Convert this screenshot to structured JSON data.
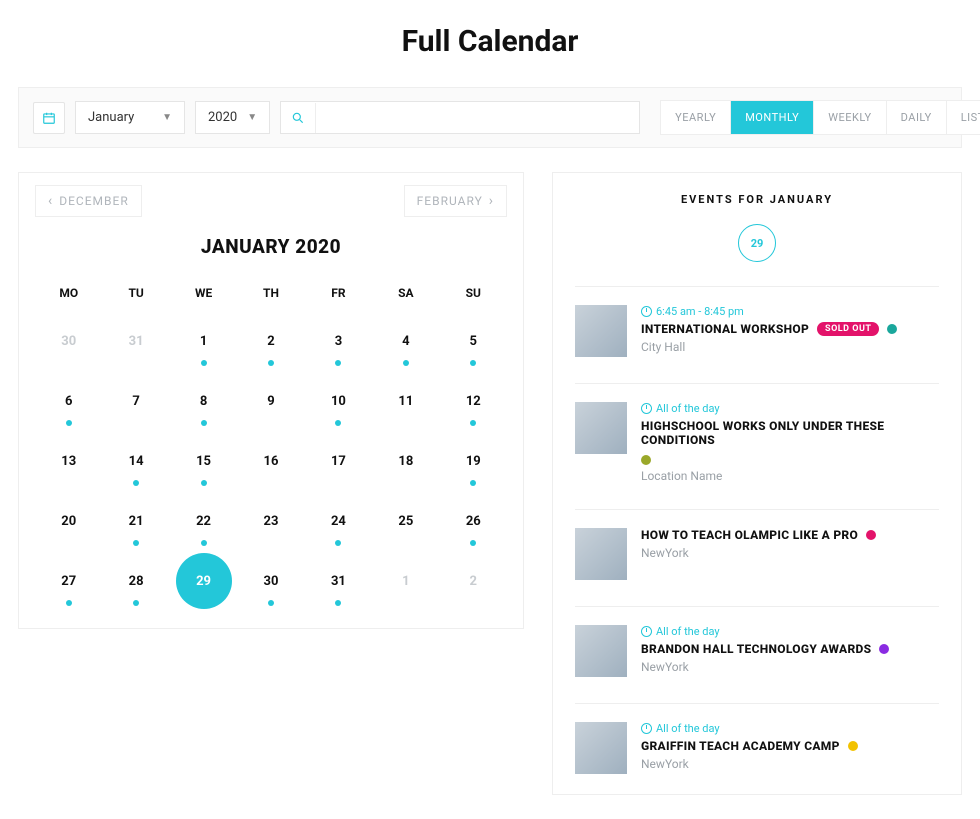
{
  "title": "Full Calendar",
  "toolbar": {
    "month_select": "January",
    "year_select": "2020",
    "views": [
      "YEARLY",
      "MONTHLY",
      "WEEKLY",
      "DAILY",
      "LIST"
    ],
    "active_view": "MONTHLY"
  },
  "calendar": {
    "prev_label": "DECEMBER",
    "next_label": "FEBRUARY",
    "heading": "JANUARY 2020",
    "weekdays": [
      "MO",
      "TU",
      "WE",
      "TH",
      "FR",
      "SA",
      "SU"
    ],
    "weeks": [
      [
        {
          "num": "30",
          "dim": true,
          "dot": false
        },
        {
          "num": "31",
          "dim": true,
          "dot": false
        },
        {
          "num": "1",
          "dot": true
        },
        {
          "num": "2",
          "dot": true
        },
        {
          "num": "3",
          "dot": true
        },
        {
          "num": "4",
          "dot": true
        },
        {
          "num": "5",
          "dot": true
        }
      ],
      [
        {
          "num": "6",
          "dot": true
        },
        {
          "num": "7",
          "dot": false
        },
        {
          "num": "8",
          "dot": true
        },
        {
          "num": "9",
          "dot": false
        },
        {
          "num": "10",
          "dot": true
        },
        {
          "num": "11",
          "dot": false
        },
        {
          "num": "12",
          "dot": true
        }
      ],
      [
        {
          "num": "13",
          "dot": false
        },
        {
          "num": "14",
          "dot": true
        },
        {
          "num": "15",
          "dot": true
        },
        {
          "num": "16",
          "dot": false
        },
        {
          "num": "17",
          "dot": false
        },
        {
          "num": "18",
          "dot": false
        },
        {
          "num": "19",
          "dot": true
        }
      ],
      [
        {
          "num": "20",
          "dot": false
        },
        {
          "num": "21",
          "dot": true
        },
        {
          "num": "22",
          "dot": true
        },
        {
          "num": "23",
          "dot": false
        },
        {
          "num": "24",
          "dot": true
        },
        {
          "num": "25",
          "dot": false
        },
        {
          "num": "26",
          "dot": true
        }
      ],
      [
        {
          "num": "27",
          "dot": true
        },
        {
          "num": "28",
          "dot": true
        },
        {
          "num": "29",
          "dot": false,
          "selected": true
        },
        {
          "num": "30",
          "dot": true
        },
        {
          "num": "31",
          "dot": true
        },
        {
          "num": "1",
          "dim": true,
          "dot": false
        },
        {
          "num": "2",
          "dim": true,
          "dot": false
        }
      ]
    ]
  },
  "events": {
    "header": "EVENTS FOR JANUARY",
    "selected_day": "29",
    "items": [
      {
        "time": "6:45 am - 8:45 pm",
        "title": "INTERNATIONAL WORKSHOP",
        "badge": "SOLD OUT",
        "dot_color": "#1aa79c",
        "location": "City Hall"
      },
      {
        "time": "All of the day",
        "title": "HIGHSCHOOL WORKS ONLY UNDER THESE CONDITIONS",
        "dot_color": "#9aa82a",
        "location": "Location Name"
      },
      {
        "time": "",
        "title": "HOW TO TEACH OLAMPIC LIKE A PRO",
        "dot_color": "#e3136a",
        "location": "NewYork"
      },
      {
        "time": "All of the day",
        "title": "BRANDON HALL TECHNOLOGY AWARDS",
        "dot_color": "#8a2be2",
        "location": "NewYork"
      },
      {
        "time": "All of the day",
        "title": "GRAIFFIN TEACH ACADEMY CAMP",
        "dot_color": "#f2c200",
        "location": "NewYork"
      }
    ]
  }
}
